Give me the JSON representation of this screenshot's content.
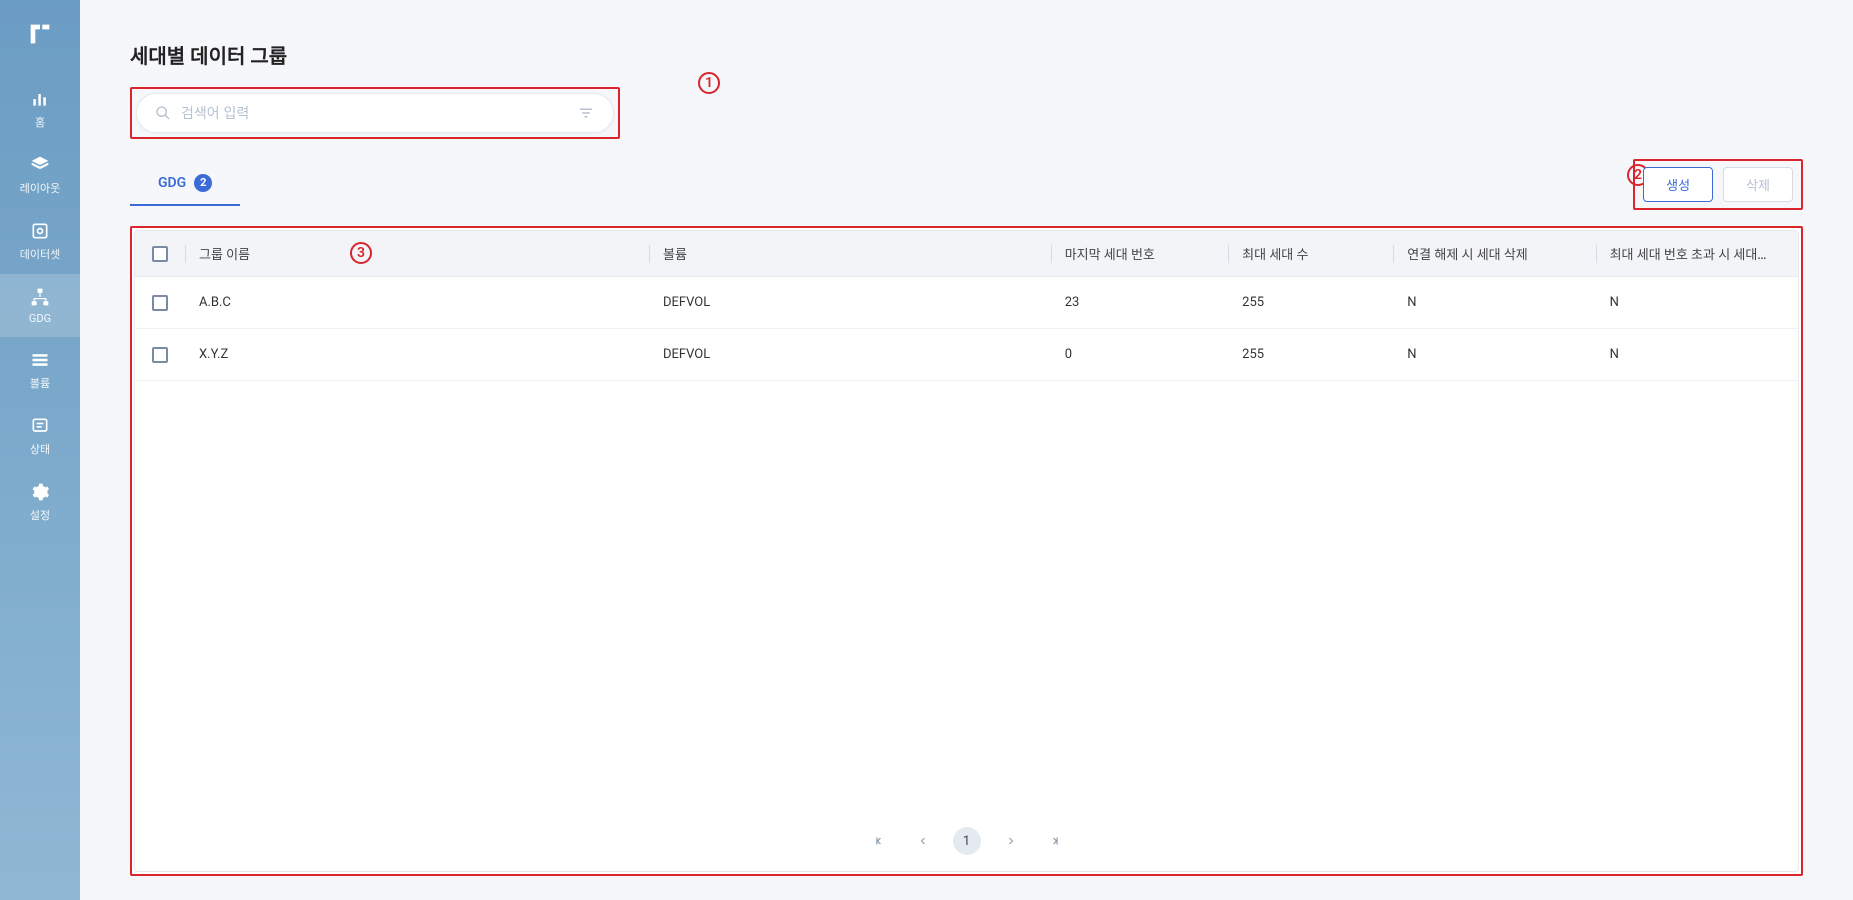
{
  "sidebar": {
    "items": [
      {
        "label": "홈",
        "icon": "bar-chart"
      },
      {
        "label": "레이아웃",
        "icon": "layers"
      },
      {
        "label": "데이터셋",
        "icon": "box"
      },
      {
        "label": "GDG",
        "icon": "sitemap",
        "active": true
      },
      {
        "label": "볼륨",
        "icon": "menu"
      },
      {
        "label": "상태",
        "icon": "note"
      },
      {
        "label": "설정",
        "icon": "gear"
      }
    ]
  },
  "page": {
    "title": "세대별 데이터 그룹"
  },
  "search": {
    "placeholder": "검색어 입력"
  },
  "tabs": {
    "current": {
      "label": "GDG",
      "count": "2"
    }
  },
  "actions": {
    "create": "생성",
    "delete": "삭제"
  },
  "table": {
    "columns": {
      "name": "그룹 이름",
      "volume": "볼륨",
      "last_gen": "마지막 세대 번호",
      "max_gen": "최대 세대 수",
      "delete_on_disconnect": "연결 해제 시 세대 삭제",
      "delete_on_overflow": "최대 세대 번호 초과 시 세대…"
    },
    "rows": [
      {
        "name": "A.B.C",
        "volume": "DEFVOL",
        "last_gen": "23",
        "max_gen": "255",
        "delete_on_disconnect": "N",
        "delete_on_overflow": "N"
      },
      {
        "name": "X.Y.Z",
        "volume": "DEFVOL",
        "last_gen": "0",
        "max_gen": "255",
        "delete_on_disconnect": "N",
        "delete_on_overflow": "N"
      }
    ]
  },
  "pagination": {
    "current": "1"
  },
  "annotations": {
    "a1": "1",
    "a2": "2",
    "a3": "3"
  }
}
